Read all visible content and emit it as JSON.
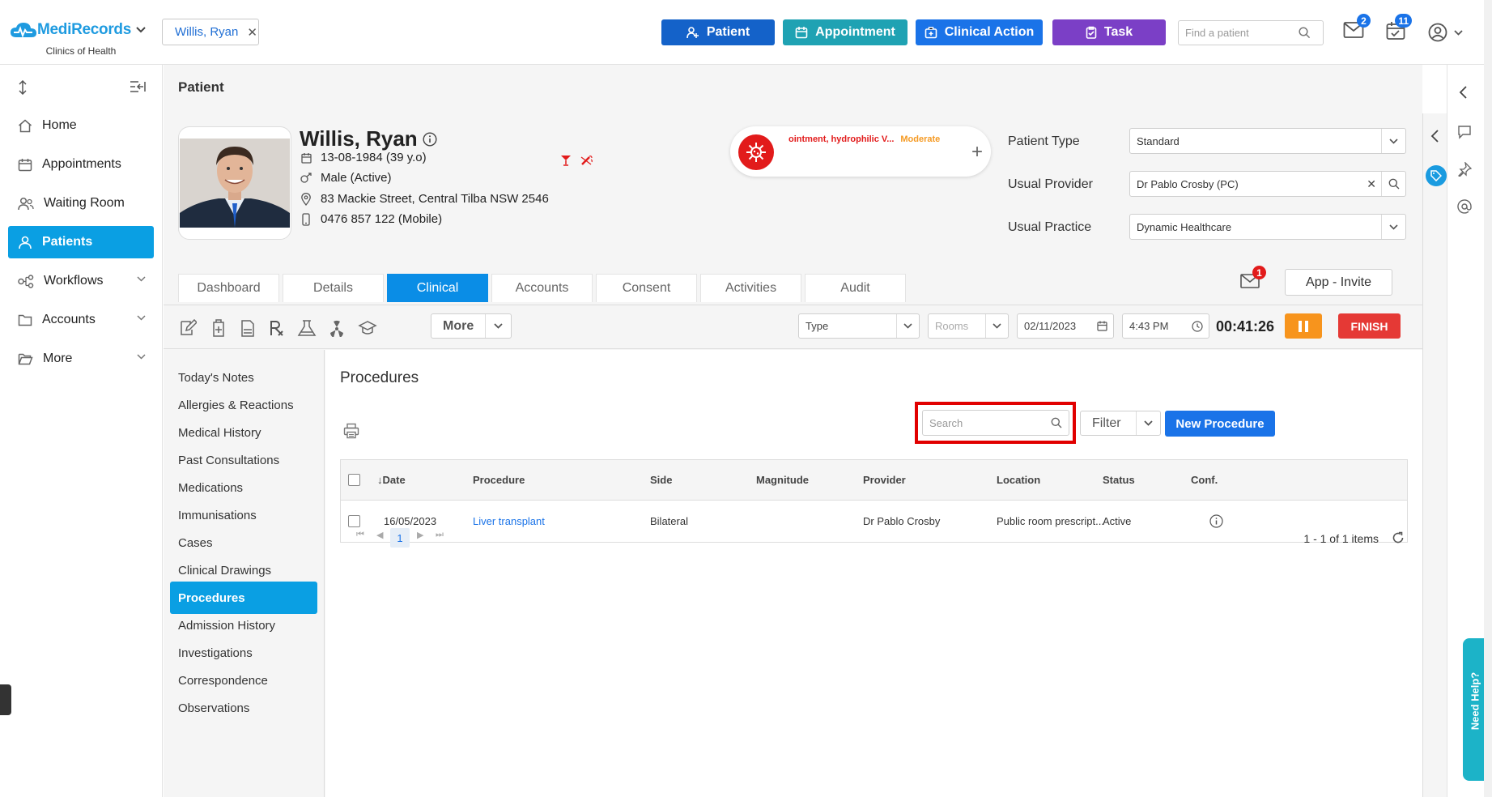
{
  "app": {
    "logo_text": "MediRecords",
    "logo_sub": "Clinics of Health",
    "patient_chip": "Willis, Ryan"
  },
  "top_buttons": {
    "patient": "Patient",
    "appointment": "Appointment",
    "clinical_action": "Clinical Action",
    "task": "Task"
  },
  "colors": {
    "patient_btn": "#1462c9",
    "appointment_btn": "#1fa2b3",
    "clinical_action_btn": "#1a73e8",
    "task_btn": "#7b3fc6",
    "active_nav": "#0a9fe3",
    "alert_red": "#e21b1b",
    "highlight_box": "#e10000"
  },
  "find_patient": {
    "placeholder": "Find a patient"
  },
  "badges": {
    "messages": "2",
    "tasks": "11",
    "app_mail": "1"
  },
  "sidebar": {
    "items": [
      {
        "label": "Home",
        "icon": "home-icon"
      },
      {
        "label": "Appointments",
        "icon": "calendar-icon"
      },
      {
        "label": "Waiting Room",
        "icon": "people-icon"
      },
      {
        "label": "Patients",
        "icon": "user-icon"
      },
      {
        "label": "Workflows",
        "icon": "workflow-icon"
      },
      {
        "label": "Accounts",
        "icon": "folder-icon"
      },
      {
        "label": "More",
        "icon": "folder-open-icon"
      }
    ]
  },
  "breadcrumb": "Patient",
  "patient": {
    "name": "Willis, Ryan",
    "dob": "13-08-1984 (39 y.o)",
    "gender": "Male (Active)",
    "address": "83 Mackie Street, Central Tilba NSW 2546",
    "phone": "0476 857 122 (Mobile)",
    "alert_text": "ointment, hydrophilic V...",
    "alert_severity": "Moderate",
    "type_label": "Patient Type",
    "type_value": "Standard",
    "provider_label": "Usual Provider",
    "provider_value": "Dr Pablo Crosby (PC)",
    "practice_label": "Usual Practice",
    "practice_value": "Dynamic Healthcare"
  },
  "tabs": [
    "Dashboard",
    "Details",
    "Clinical",
    "Accounts",
    "Consent",
    "Activities",
    "Audit"
  ],
  "app_invite": "App - Invite",
  "toolbar": {
    "more": "More",
    "type_placeholder": "Type",
    "rooms_placeholder": "Rooms",
    "date": "02/11/2023",
    "time": "4:43 PM",
    "timer": "00:41:26",
    "finish": "FINISH"
  },
  "subnav": [
    "Today's Notes",
    "Allergies & Reactions",
    "Medical History",
    "Past Consultations",
    "Medications",
    "Immunisations",
    "Cases",
    "Clinical Drawings",
    "Procedures",
    "Admission History",
    "Investigations",
    "Correspondence",
    "Observations"
  ],
  "procedures": {
    "title": "Procedures",
    "search_placeholder": "Search",
    "filter": "Filter",
    "new_button": "New Procedure",
    "columns": [
      "↓Date",
      "Procedure",
      "Side",
      "Magnitude",
      "Provider",
      "Location",
      "Status",
      "Conf."
    ],
    "rows": [
      {
        "date": "16/05/2023",
        "procedure": "Liver transplant",
        "side": "Bilateral",
        "magnitude": "",
        "provider": "Dr Pablo Crosby",
        "location": "Public room prescript...",
        "status": "Active"
      }
    ],
    "current_page": "1",
    "count_text": "1 - 1 of 1 items"
  },
  "help": "Need Help?"
}
